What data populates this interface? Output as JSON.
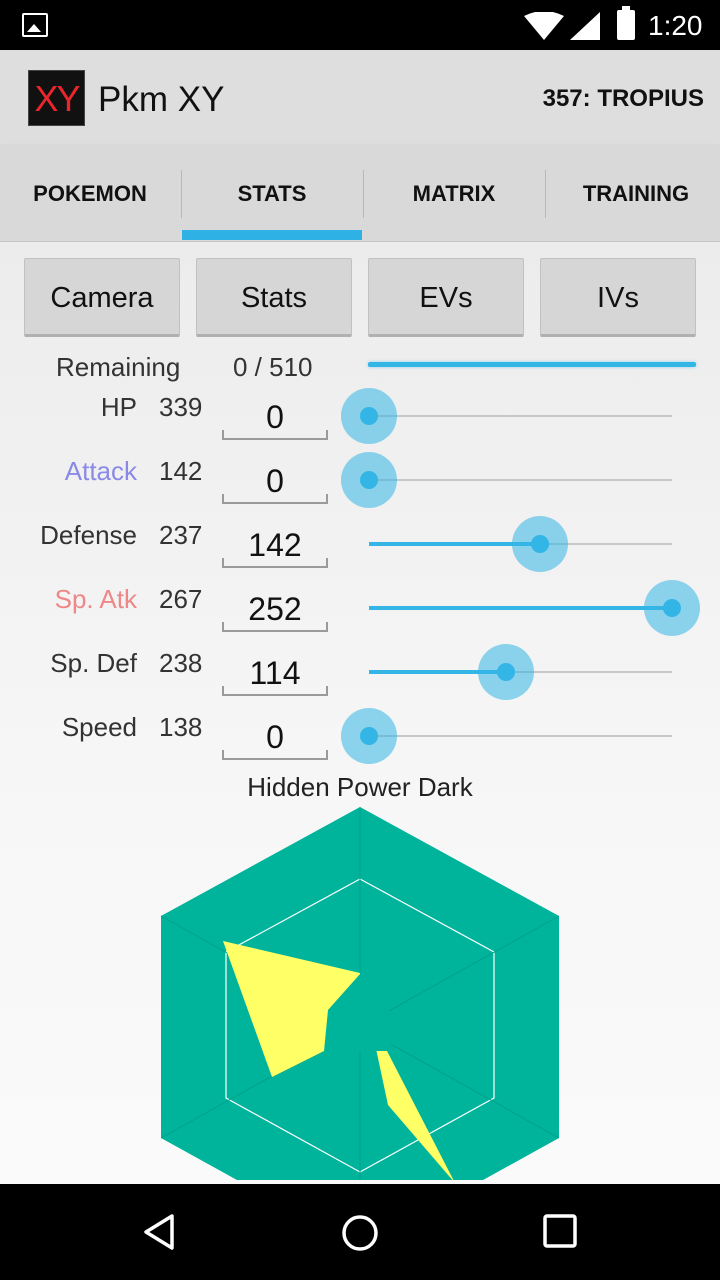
{
  "status_bar": {
    "time": "1:20"
  },
  "app": {
    "logo": "XY",
    "title": "Pkm XY",
    "pokemon": "357: TROPIUS"
  },
  "tabs": [
    {
      "label": "POKEMON",
      "active": false
    },
    {
      "label": "STATS",
      "active": true
    },
    {
      "label": "MATRIX",
      "active": false
    },
    {
      "label": "TRAINING",
      "active": false
    }
  ],
  "mode_buttons": [
    "Camera",
    "Stats",
    "EVs",
    "IVs"
  ],
  "remaining": {
    "label": "Remaining",
    "value": "0 / 510",
    "used": 510,
    "max": 510
  },
  "stats": [
    {
      "name": "HP",
      "total": "339",
      "ev": "0",
      "ev_num": 0,
      "color": "#333333"
    },
    {
      "name": "Attack",
      "total": "142",
      "ev": "0",
      "ev_num": 0,
      "color": "#8a8ae6"
    },
    {
      "name": "Defense",
      "total": "237",
      "ev": "142",
      "ev_num": 142,
      "color": "#333333"
    },
    {
      "name": "Sp. Atk",
      "total": "267",
      "ev": "252",
      "ev_num": 252,
      "color": "#ee8888"
    },
    {
      "name": "Sp. Def",
      "total": "238",
      "ev": "114",
      "ev_num": 114,
      "color": "#333333"
    },
    {
      "name": "Speed",
      "total": "138",
      "ev": "0",
      "ev_num": 0,
      "color": "#333333"
    }
  ],
  "ev_max": 252,
  "hidden_power": "Hidden Power Dark",
  "colors": {
    "accent": "#33b5e5",
    "radar_bg": "#00b49c",
    "radar_fill": "#ffff66"
  }
}
